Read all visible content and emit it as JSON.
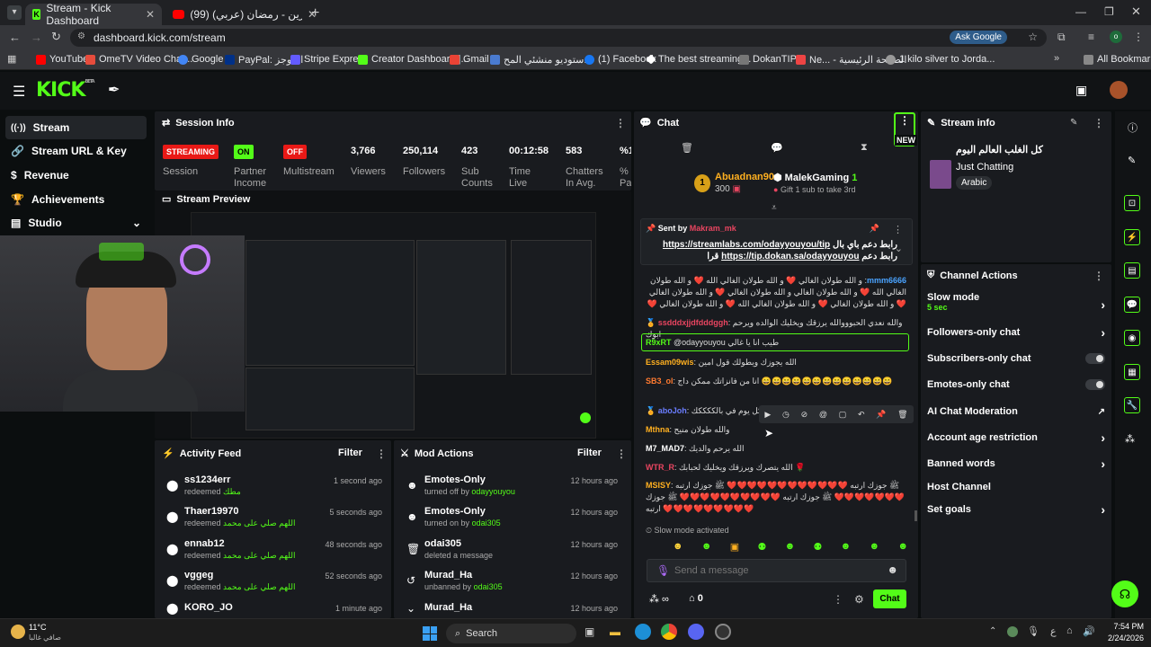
{
  "browser": {
    "tabs": [
      {
        "title": "Stream - Kick Dashboard",
        "active": true
      },
      {
        "title": "(99) ماهر زين - رمضان (عربي) |",
        "active": false
      }
    ],
    "url": "dashboard.kick.com/stream",
    "ask_google": "Ask Google",
    "bookmarks": [
      "YouTube",
      "OmeTV Video Chat...",
      "Google",
      "PayPal: الموجز",
      "Stripe Express",
      "Creator Dashboard |...",
      "Gmail",
      "ستوديو منشئي المح...",
      "(1) Facebook",
      "The best streaming...",
      "DokanTIP",
      "Ne... - الصفحة الرئيسية",
      "1 kilo silver to Jorda..."
    ],
    "all_bookmarks": "All Bookmarks"
  },
  "kick": {
    "logo": "KICK",
    "logo_beta": "BETA"
  },
  "sidebar": {
    "items": [
      "Stream",
      "Stream URL & Key",
      "Revenue",
      "Achievements",
      "Studio"
    ]
  },
  "session": {
    "title": "Session Info",
    "badges": [
      {
        "text": "STREAMING",
        "label": "Session",
        "color": "#e91916"
      },
      {
        "text": "ON",
        "label": "Partner Income",
        "color": "#53fc18"
      },
      {
        "text": "OFF",
        "label": "Multistream",
        "color": "#e91916"
      }
    ],
    "stats": [
      {
        "value": "3,766",
        "label": "Viewers"
      },
      {
        "value": "250,114",
        "label": "Followers"
      },
      {
        "value": "423",
        "label": "Sub Counts"
      },
      {
        "value": "00:12:58",
        "label": "Time Live"
      },
      {
        "value": "583",
        "label": "Chatters In Avg."
      },
      {
        "value": "%1",
        "label": "% Pa"
      }
    ]
  },
  "preview": {
    "title": "Stream Preview"
  },
  "activity": {
    "title": "Activity Feed",
    "filter": "Filter",
    "items": [
      {
        "name": "ss1234err",
        "action": "redeemed",
        "reward": "مطك",
        "time": "1 second ago"
      },
      {
        "name": "Thaer19970",
        "action": "redeemed",
        "reward": "اللهم صلي على محمد",
        "time": "5 seconds ago"
      },
      {
        "name": "ennab12",
        "action": "redeemed",
        "reward": "اللهم صلي على محمد",
        "time": "48 seconds ago"
      },
      {
        "name": "vggeg",
        "action": "redeemed",
        "reward": "اللهم صلي على محمد",
        "time": "52 seconds ago"
      },
      {
        "name": "KORO_JO",
        "action": "",
        "reward": "",
        "time": "1 minute ago"
      }
    ]
  },
  "mod": {
    "title": "Mod Actions",
    "filter": "Filter",
    "items": [
      {
        "name": "Emotes-Only",
        "action": "turned off by",
        "by": "odayyouyou",
        "time": "12 hours ago"
      },
      {
        "name": "Emotes-Only",
        "action": "turned on by",
        "by": "odai305",
        "time": "12 hours ago"
      },
      {
        "name": "odai305",
        "action": "deleted a message",
        "by": "",
        "time": "12 hours ago"
      },
      {
        "name": "Murad_Ha",
        "action": "unbanned by",
        "by": "odai305",
        "time": "12 hours ago"
      },
      {
        "name": "Murad_Ha",
        "action": "",
        "by": "",
        "time": "12 hours ago"
      }
    ]
  },
  "chat": {
    "title": "Chat",
    "new_label": "NEW",
    "leader1": {
      "rank": "1",
      "name": "Abuadnan90",
      "amount": "300"
    },
    "leader2": {
      "name": "MalekGaming",
      "count": "1",
      "sub": "Gift 1 sub to take 3rd"
    },
    "pinned": {
      "sent_by": "Sent by",
      "user": "Makram_mk",
      "text1": "رابط دعم باي بال",
      "link1": "https://streamlabs.com/odayyouyou/tip",
      "text2": "رابط دعم",
      "link2": "https://tip.dokan.sa/odayyouyou",
      "text3": "قرا"
    },
    "messages": [
      {
        "user": "mmm6666",
        "color": "#4aa3ff",
        "text": "و الله طولان الغالي ❤️ و الله طولان الغالي الله ❤️ و الله طولان الغالي الله ❤️ و الله طولان الغالي و الله طولان الغالي ❤️ و الله طولان الغالي ❤️ و الله طولان الغالي ❤️ و الله طولان الغالي الله ❤️ و الله طولان الغالي ❤️"
      },
      {
        "user": "ssdddxjjdfdddggh",
        "color": "#e94560",
        "text": "والله نعدي الحبوووالله يرزقك ويخليك الوالده ويرحم ابوك"
      },
      {
        "user": "R9xRT",
        "color": "#53fc18",
        "text": "@odayyouyou طيب انا يا غالي"
      },
      {
        "user": "Essam09wis",
        "color": "#ffb020",
        "text": "الله يجوزك ويطولك قول امين"
      },
      {
        "user": "SB3_ol",
        "color": "#ff7a30",
        "text": "انا من فانزاتك ممكن داج 😄😄😄😄😄😄😄😄😄😄😄😄😄"
      },
      {
        "user": "aboJoh",
        "color": "#6a7dff",
        "text": "يلمدار كل يوم في بالككككك"
      },
      {
        "user": "Mthna",
        "color": "#ffb020",
        "text": "والله طولان منيح"
      },
      {
        "user": "M7_MAD7",
        "color": "#ffffff",
        "text": "الله يرحم والديك"
      },
      {
        "user": "WTR_R",
        "color": "#e94560",
        "text": "الله يتصرك ويرزقك ويخليك لحبابك 🌹"
      },
      {
        "user": "MSISY",
        "color": "#ffb020",
        "text": "ﷺ جوزك ارتبه ❤️❤️❤️❤️❤️❤️❤️❤️❤️❤️❤️❤️ ﷺ جوزك ارتبه ❤️❤️❤️❤️❤️❤️❤️ ﷺ جوزك ارتبه ❤️❤️❤️❤️❤️❤️❤️❤️❤️❤️ ﷺ جوزك ارتبه ❤️❤️❤️❤️❤️❤️❤️❤️❤️"
      }
    ],
    "slow_mode_activated": "Slow mode activated",
    "send_placeholder": "Send a message",
    "points": "0",
    "chat_button": "Chat"
  },
  "stream_info": {
    "title": "Stream info",
    "stream_title": "كل الغلب العالم اليوم",
    "category": "Just Chatting",
    "tag": "Arabic"
  },
  "channel_actions": {
    "title": "Channel Actions",
    "items": [
      {
        "label": "Slow mode",
        "sub": "5 sec",
        "control": "chevron"
      },
      {
        "label": "Followers-only chat",
        "sub": "",
        "control": "chevron"
      },
      {
        "label": "Subscribers-only chat",
        "sub": "",
        "control": "toggle"
      },
      {
        "label": "Emotes-only chat",
        "sub": "",
        "control": "toggle"
      },
      {
        "label": "AI Chat Moderation",
        "sub": "",
        "control": "external"
      },
      {
        "label": "Account age restriction",
        "sub": "",
        "control": "chevron"
      },
      {
        "label": "Banned words",
        "sub": "",
        "control": "chevron"
      },
      {
        "label": "Host Channel",
        "sub": "",
        "control": "none"
      },
      {
        "label": "Set goals",
        "sub": "",
        "control": "chevron"
      }
    ]
  },
  "taskbar": {
    "weather_temp": "11°C",
    "weather_desc": "صافي غالبا",
    "search": "Search",
    "time": "7:54 PM",
    "date": "2/24/2026",
    "lang": "ع"
  },
  "colors": {
    "accent": "#53fc18",
    "live_red": "#e91916"
  }
}
